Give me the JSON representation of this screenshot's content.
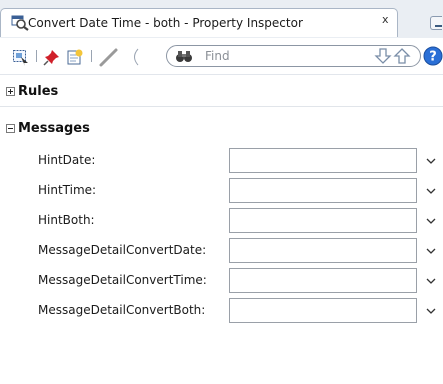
{
  "window": {
    "title": "Convert Date Time - both - Property Inspector",
    "close_glyph": "x"
  },
  "toolbar": {
    "search_placeholder": "Find",
    "icons": [
      "select-in-editor-icon",
      "pin-icon",
      "edit-component-icon",
      "pencil-icon",
      "binoculars-icon",
      "arrow-down-icon",
      "arrow-up-icon",
      "help-icon"
    ],
    "help_glyph": "?"
  },
  "sections": {
    "rules": {
      "label": "Rules",
      "expanded": false
    },
    "messages": {
      "label": "Messages",
      "expanded": true
    }
  },
  "messages": {
    "rows": [
      {
        "label": "HintDate:",
        "value": ""
      },
      {
        "label": "HintTime:",
        "value": ""
      },
      {
        "label": "HintBoth:",
        "value": ""
      },
      {
        "label": "MessageDetailConvertDate:",
        "value": ""
      },
      {
        "label": "MessageDetailConvertTime:",
        "value": ""
      },
      {
        "label": "MessageDetailConvertBoth:",
        "value": ""
      }
    ]
  },
  "colors": {
    "titlebar_bg": "#eaeef3",
    "tab_border": "#aab6c6",
    "help_blue": "#2a6fd6",
    "pin_red": "#d0202a",
    "nav_arrow": "#7a8ea8"
  }
}
